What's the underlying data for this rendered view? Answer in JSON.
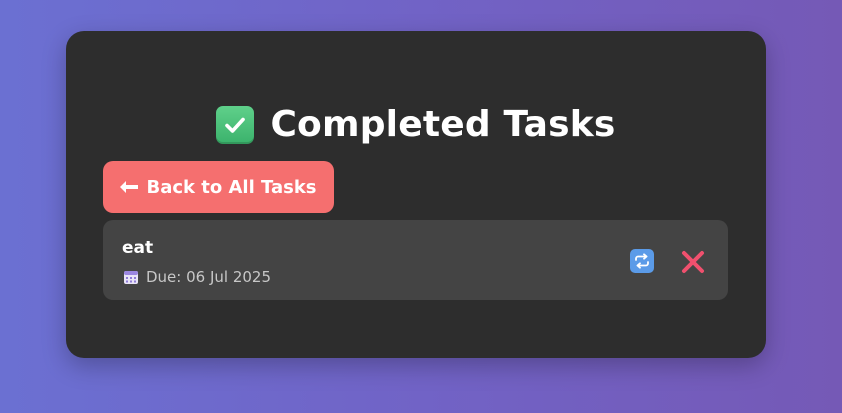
{
  "header": {
    "title": "Completed Tasks",
    "title_icon": "check-mark-button-icon"
  },
  "actions": {
    "back_label": "Back to All Tasks",
    "back_icon": "left-arrow-icon"
  },
  "tasks": [
    {
      "name": "eat",
      "due_label": "Due: 06 Jul 2025",
      "due_icon": "calendar-icon",
      "restore_icon": "repeat-icon",
      "delete_icon": "cross-mark-icon"
    }
  ],
  "colors": {
    "background_start": "#6b70d2",
    "background_end": "#7559b6",
    "card": "#2d2d2d",
    "task_item": "#444444",
    "back_button": "#f56f6f",
    "check_green": "#4cc27a",
    "restore_blue": "#5b9be8",
    "delete_pink": "#f0506e"
  }
}
